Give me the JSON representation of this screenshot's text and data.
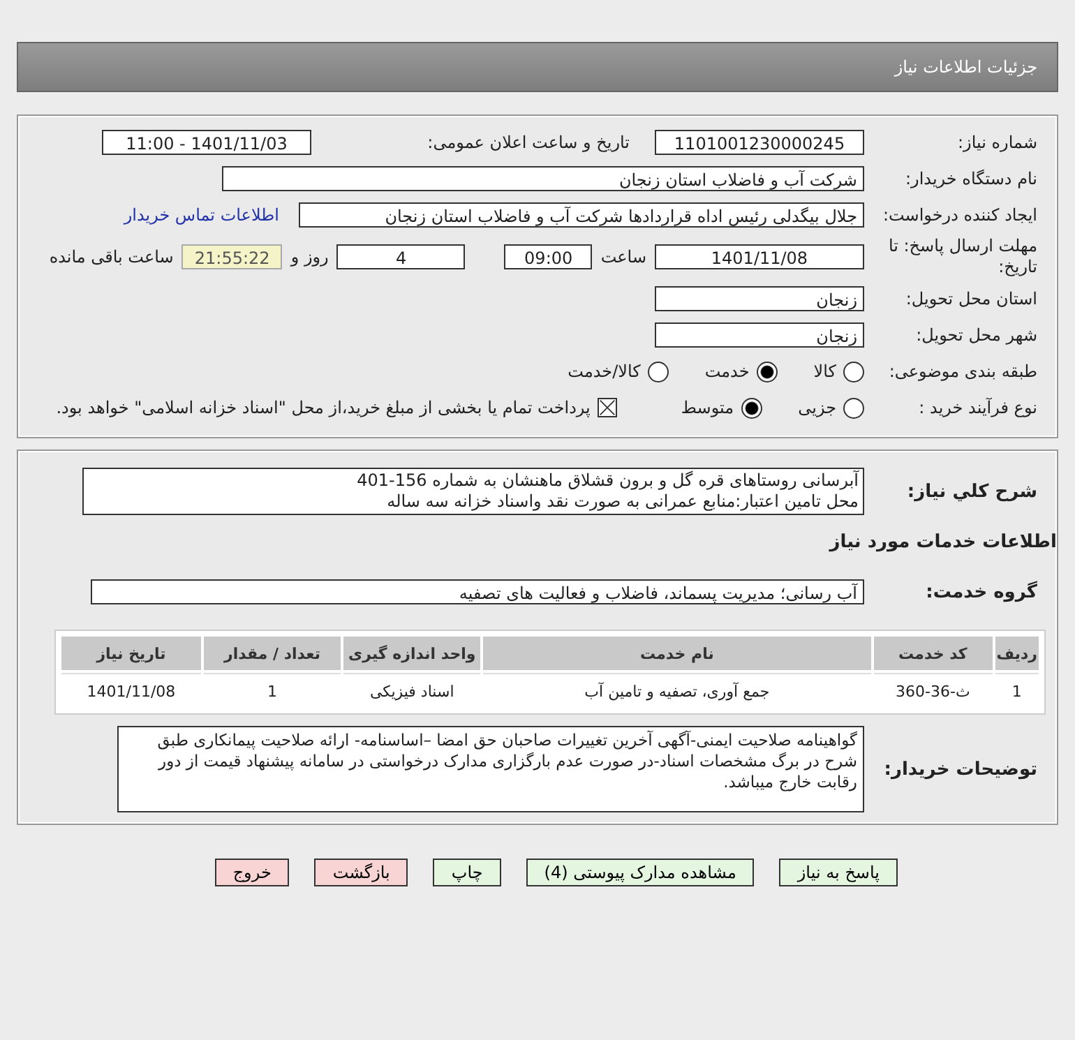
{
  "header": {
    "title": "جزئیات اطلاعات نیاز"
  },
  "need_number": {
    "label": "شماره نیاز:",
    "value": "1101001230000245"
  },
  "announce": {
    "label": "تاریخ و ساعت اعلان عمومی:",
    "value": "1401/11/03 - 11:00"
  },
  "buyer_org": {
    "label": "نام دستگاه خریدار:",
    "value": "شرکت آب و فاضلاب استان زنجان"
  },
  "requester": {
    "label": "ایجاد کننده درخواست:",
    "value": "جلال بیگدلی رئیس اداه قراردادها شرکت آب و فاضلاب استان زنجان",
    "link": "اطلاعات تماس خریدار"
  },
  "deadline": {
    "label": "مهلت ارسال پاسخ: تا تاریخ:",
    "date": "1401/11/08",
    "time_label": "ساعت",
    "time": "09:00",
    "days": "4",
    "days_label": "روز و",
    "remaining": "21:55:22",
    "remaining_label": "ساعت باقی مانده"
  },
  "province": {
    "label": "استان محل تحویل:",
    "value": "زنجان"
  },
  "city": {
    "label": "شهر محل تحویل:",
    "value": "زنجان"
  },
  "category": {
    "label": "طبقه بندی موضوعی:",
    "options": [
      {
        "label": "کالا",
        "selected": false
      },
      {
        "label": "خدمت",
        "selected": true
      },
      {
        "label": "کالا/خدمت",
        "selected": false
      }
    ]
  },
  "purchase_type": {
    "label": "نوع فرآیند خرید :",
    "options": [
      {
        "label": "جزیی",
        "selected": false
      },
      {
        "label": "متوسط",
        "selected": true
      }
    ],
    "treasury": {
      "checked": true,
      "text": "پرداخت تمام یا بخشی از مبلغ خرید،از محل \"اسناد خزانه اسلامی\" خواهد بود."
    }
  },
  "description": {
    "label": "شرح کلي نياز:",
    "lines": [
      "آبرسانی روستاهای قره گل و برون قشلاق ماهنشان به شماره 156-401",
      "محل تامین اعتبار:منابع عمرانی به صورت نقد واسناد خزانه سه ساله"
    ]
  },
  "services_title": "اطلاعات خدمات مورد نياز",
  "service_group": {
    "label": "گروه خدمت:",
    "value": "آب رسانی؛ مدیریت پسماند، فاضلاب و فعالیت های تصفیه"
  },
  "table": {
    "columns": [
      "ردیف",
      "کد خدمت",
      "نام خدمت",
      "واحد اندازه گیری",
      "تعداد / مقدار",
      "تاریخ نیاز"
    ],
    "rows": [
      [
        "1",
        "ث-36-360",
        "جمع آوری، تصفیه و تامین آب",
        "اسناد فیزیکی",
        "1",
        "1401/11/08"
      ]
    ]
  },
  "notes": {
    "label": "توضیحات خریدار:",
    "value": "گواهینامه صلاحیت ایمنی-آگهی آخرین تغییرات صاحبان حق امضا –اساسنامه- ارائه صلاحیت پیمانکاری طبق شرح در برگ مشخصات اسناد-در صورت عدم بارگزاری مدارک درخواستی در سامانه پیشنهاد قیمت از دور رقابت خارج میباشد."
  },
  "buttons": [
    {
      "label": "پاسخ به نیاز",
      "kind": "primary"
    },
    {
      "label": "مشاهده مدارک پیوستی (4)",
      "kind": "primary"
    },
    {
      "label": "چاپ",
      "kind": "primary"
    },
    {
      "label": "بازگشت",
      "kind": "danger"
    },
    {
      "label": "خروج",
      "kind": "danger"
    }
  ]
}
